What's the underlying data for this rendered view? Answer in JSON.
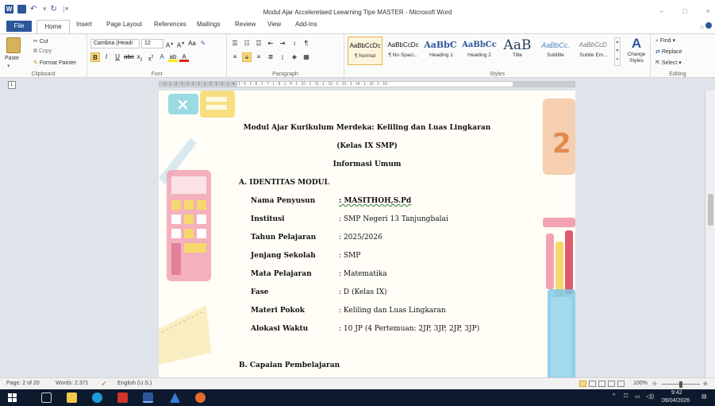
{
  "titlebar": {
    "title": "Modul Ajar Acceleretaed Leearning Tipe MASTER  -  Microsoft Word",
    "word_icon": "W",
    "minimize": "–",
    "maximize": "□",
    "close": "×"
  },
  "tabs": {
    "file": "File",
    "home": "Home",
    "insert": "Insert",
    "page_layout": "Page Layout",
    "references": "References",
    "mailings": "Mailings",
    "review": "Review",
    "view": "View",
    "addins": "Add-Ins"
  },
  "ribbon": {
    "clipboard": {
      "paste": "Paste",
      "cut": "Cut",
      "copy": "Copy",
      "format_painter": "Format Painter",
      "label": "Clipboard"
    },
    "font": {
      "font_name": "Cambria (Headi ",
      "font_size": "12",
      "label": "Font"
    },
    "paragraph": {
      "label": "Paragraph"
    },
    "styles": {
      "label": "Styles",
      "items": [
        {
          "preview": "AaBbCcDc",
          "name": "¶ Normal"
        },
        {
          "preview": "AaBbCcDc",
          "name": "¶ No Spaci..."
        },
        {
          "preview": "AaBbC ",
          "name": "Heading 1"
        },
        {
          "preview": "AaBbCc",
          "name": "Heading 2"
        },
        {
          "preview": "AaB",
          "name": "Title"
        },
        {
          "preview": "AaBbCc.",
          "name": "Subtitle"
        },
        {
          "preview": "AaBbCcD ",
          "name": "Subtle Em..."
        }
      ],
      "change_styles": "Change Styles"
    },
    "editing": {
      "find": "Find",
      "replace": "Replace",
      "select": "Select",
      "label": "Editing"
    }
  },
  "ruler": {
    "ticks": "· 2 · 1 · 3 · 1 · 2 · 1 · 1 · 1 · 2 · 1 · 3 · 1 · 4 · 1 · 5 · 1 · 6 · 1 · 7 · 1 · 8 · 1 · 9 · 1 · 10 · 1 · 11 · 1 · 12 · 1 · 13 · 1 · 14 · 1 · 15 · 1 · 16 ·",
    "tab_stop": "L"
  },
  "document": {
    "title": "Modul Ajar Kurikulum Merdeka: Keliling dan Luas Lingkaran",
    "subtitle": "(Kelas IX SMP)",
    "section_title": "Informasi Umum",
    "section_a": "A.  IDENTITAS MODUL",
    "fields": [
      {
        "label": "Nama Penyusun",
        "value": ": MASITHOH,S.Pd"
      },
      {
        "label": "Institusi",
        "value": ": SMP Negeri 13 Tanjungbalai"
      },
      {
        "label": "Tahun Pelajaran",
        "value": ": 2025/2026"
      },
      {
        "label": "Jenjang Sekolah",
        "value": ": SMP"
      },
      {
        "label": "Mata Pelajaran",
        "value": ": Matematika"
      },
      {
        "label": "Fase",
        "value": ": D (Kelas IX)"
      },
      {
        "label": "Materi Pokok",
        "value": ": Keliling dan Luas Lingkaran"
      },
      {
        "label": "Alokasi Waktu",
        "value": ": 10 JP (4 Pertemuan: 2JP, 3JP, 2JP, 3JP)"
      }
    ],
    "section_b": "B.  Capaian Pembelajaran"
  },
  "statusbar": {
    "page": "Page: 2 of 20",
    "words": "Words: 2.371",
    "language": "English (U.S.)",
    "zoom": "100%",
    "zoom_level_percent": 100
  },
  "taskbar": {
    "time": "9:42",
    "date": "09/04/2026",
    "tray_arrow": "^"
  },
  "colors": {
    "word_blue": "#2b579a",
    "canvas": "#dfe3ea",
    "taskbar": "#0d1a2d"
  }
}
